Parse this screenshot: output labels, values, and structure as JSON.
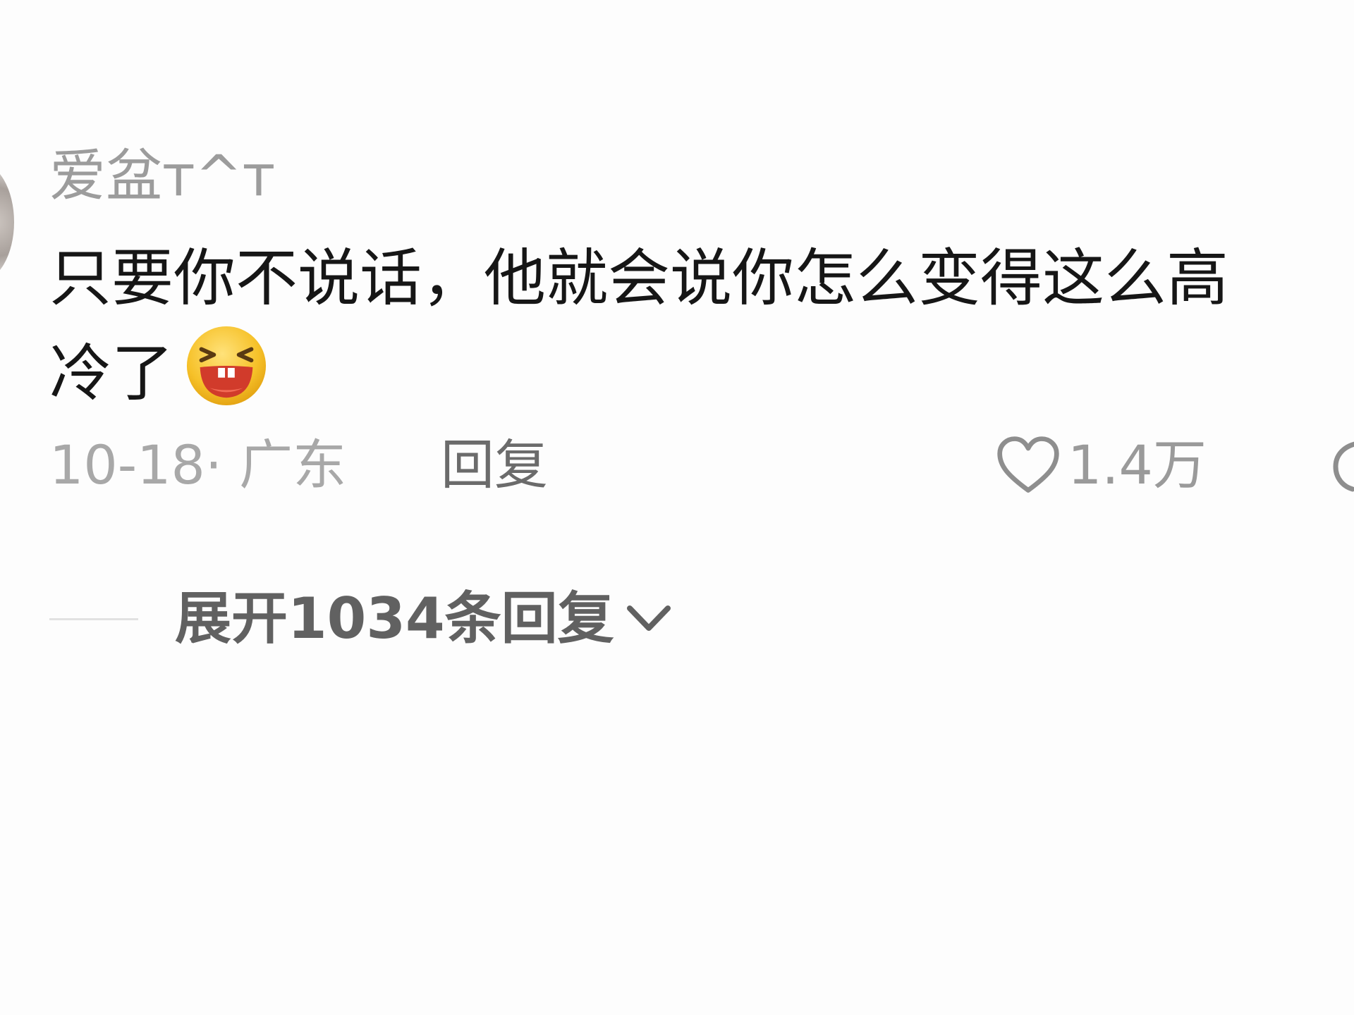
{
  "comment": {
    "username": "爱盆\b^\b",
    "username_display": "爱盆ᴛ^ᴛ",
    "content_line1": "只要你不说话，他就会说你怎么变得这么高",
    "content_line2": "冷了",
    "emoji": "laughing-face",
    "date_location": "10-18· 广东",
    "reply_label": "回复",
    "like_count": "1.4万",
    "expand_replies_label": "展开1034条回复"
  },
  "colors": {
    "background": "#fdfdfd",
    "username": "#9c9c9c",
    "content": "#161616",
    "meta": "#a8a8a8",
    "reply": "#6b6b6b",
    "expand": "#616161",
    "emoji_yellow": "#f6c129",
    "emoji_mouth": "#d13b2b"
  },
  "icons": {
    "like": "heart-outline-icon",
    "comment": "comment-bubble-icon",
    "expand": "chevron-down-icon"
  }
}
